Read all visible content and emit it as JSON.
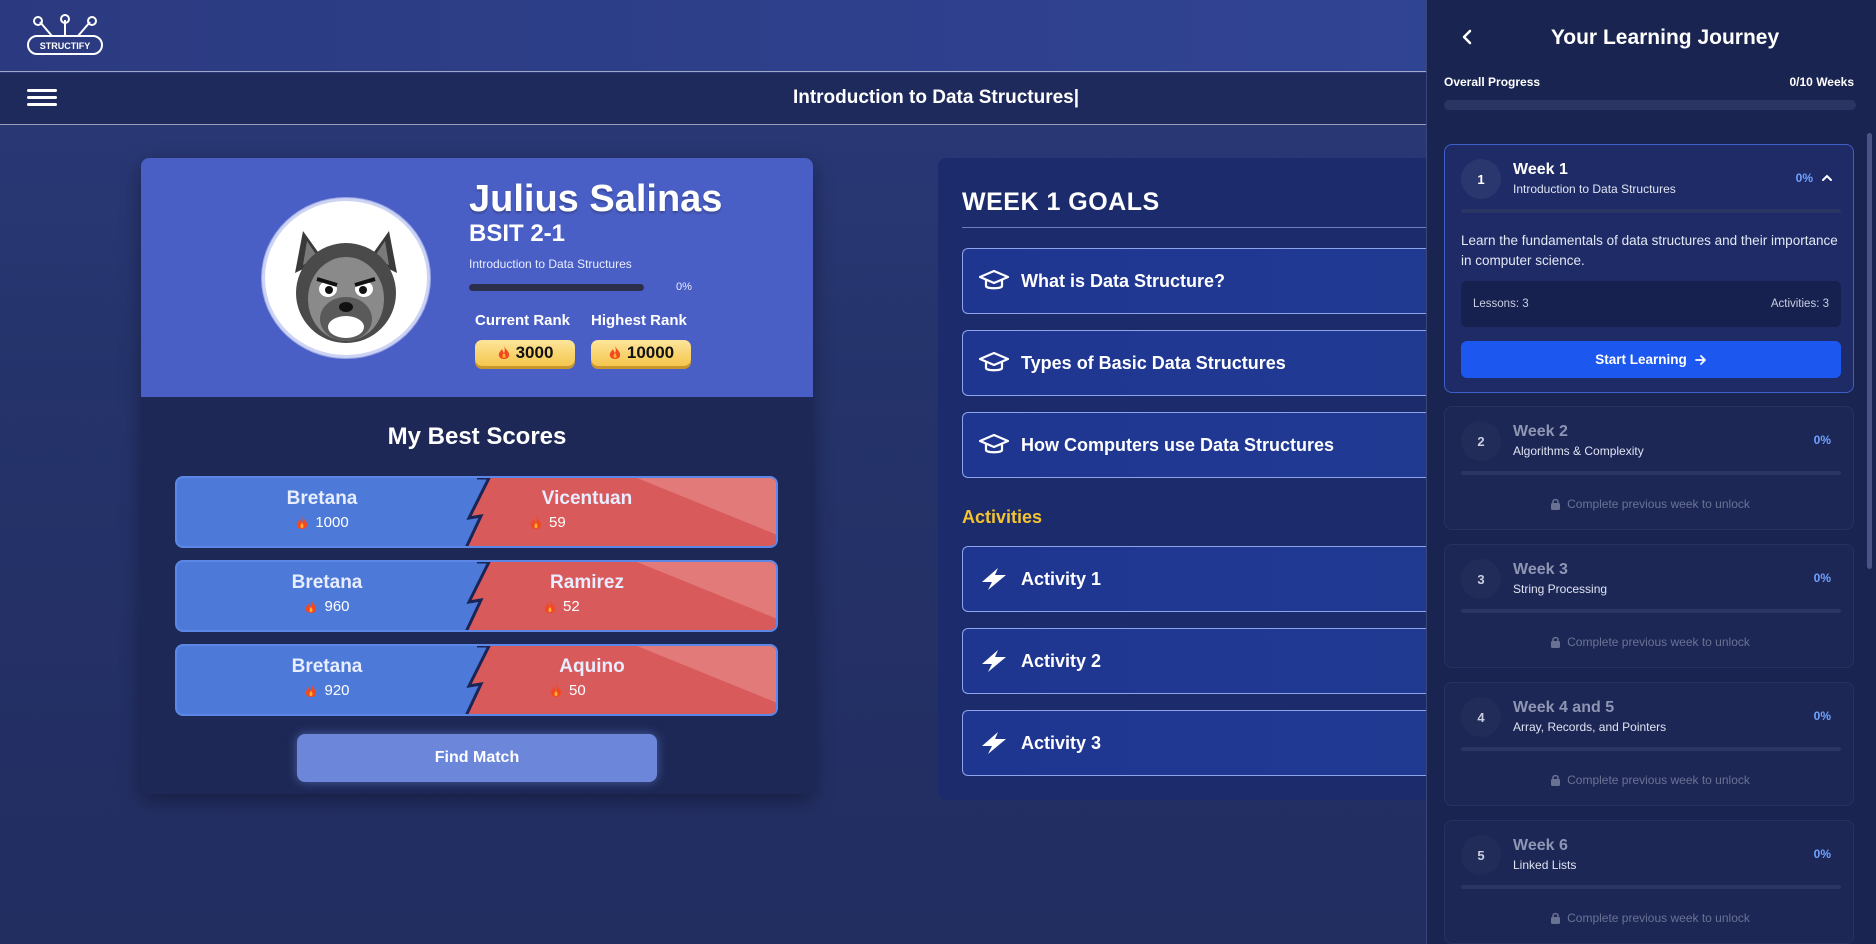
{
  "header": {
    "logo_text": "STRUCTIFY",
    "course_title": "Introduction to Data Structures|"
  },
  "profile": {
    "name": "Julius Salinas",
    "section": "BSIT 2-1",
    "course": "Introduction to Data Structures",
    "progress_pct": "0%",
    "progress_fraction": 0,
    "current_rank_label": "Current Rank",
    "current_rank": "3000",
    "highest_rank_label": "Highest Rank",
    "highest_rank": "10000"
  },
  "best_scores": {
    "title": "My Best Scores",
    "matches": [
      {
        "left_name": "Bretana",
        "left_score": "1000",
        "right_name": "Vicentuan",
        "right_score": "59"
      },
      {
        "left_name": "Bretana",
        "left_score": "960",
        "right_name": "Ramirez",
        "right_score": "52"
      },
      {
        "left_name": "Bretana",
        "left_score": "920",
        "right_name": "Aquino",
        "right_score": "50"
      }
    ],
    "find_match_label": "Find Match"
  },
  "goals": {
    "title": "WEEK 1 GOALS",
    "items": [
      "What is Data Structure?",
      "Types of Basic Data Structures",
      "How Computers use Data Structures"
    ],
    "activities_heading": "Activities",
    "activities": [
      "Activity 1",
      "Activity 2",
      "Activity 3"
    ]
  },
  "journey": {
    "title": "Your Learning Journey",
    "overall_label": "Overall Progress",
    "overall_value": "0/10 Weeks",
    "overall_fraction": 0,
    "locked_text": "Complete previous week to unlock",
    "weeks": [
      {
        "num": "1",
        "title": "Week 1",
        "subtitle": "Introduction to Data Structures",
        "pct": "0%",
        "description": "Learn the fundamentals of data structures and their importance in computer science.",
        "lessons": "Lessons: 3",
        "activities": "Activities: 3",
        "button": "Start Learning"
      },
      {
        "num": "2",
        "title": "Week 2",
        "subtitle": "Algorithms & Complexity",
        "pct": "0%"
      },
      {
        "num": "3",
        "title": "Week 3",
        "subtitle": "String Processing",
        "pct": "0%"
      },
      {
        "num": "4",
        "title": "Week 4 and 5",
        "subtitle": "Array, Records, and Pointers",
        "pct": "0%"
      },
      {
        "num": "5",
        "title": "Week 6",
        "subtitle": "Linked Lists",
        "pct": "0%"
      }
    ]
  },
  "colors": {
    "accent_blue": "#1c58f0",
    "activities_yellow": "#f4c430",
    "rank_gold": "#f5c64d",
    "match_red": "#d95a5a",
    "match_blue": "#4d7ad8"
  },
  "icons": [
    "logo-icon",
    "menu-icon",
    "flame-icon",
    "graduation-cap-icon",
    "lightning-icon",
    "back-arrow-icon",
    "chevron-up-icon",
    "lock-icon",
    "arrow-right-icon"
  ]
}
